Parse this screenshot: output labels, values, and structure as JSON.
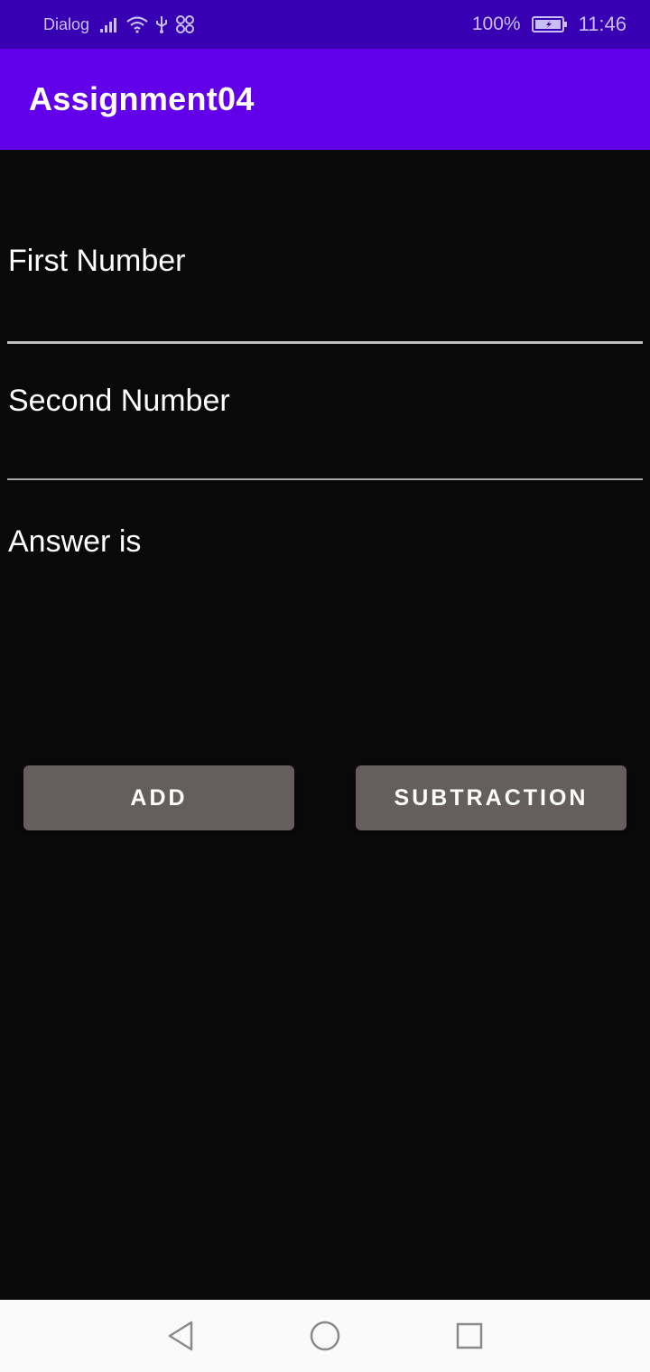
{
  "status_bar": {
    "carrier": "Dialog",
    "battery": "100%",
    "time": "11:46",
    "icons": [
      "signal-icon",
      "wifi-icon",
      "usb-icon",
      "ar-icon",
      "battery-icon"
    ]
  },
  "app_bar": {
    "title": "Assignment04"
  },
  "form": {
    "first_number_hint": "First Number",
    "second_number_hint": "Second Number",
    "answer_label": "Answer is"
  },
  "buttons": {
    "add": "ADD",
    "subtract": "SUBTRACTION"
  },
  "nav_bar": {
    "icons": [
      "back-icon",
      "home-icon",
      "recents-icon"
    ]
  },
  "colors": {
    "status_bar": "#3700b3",
    "app_bar": "#6200ea",
    "background": "#090909",
    "button": "#645f5d"
  }
}
